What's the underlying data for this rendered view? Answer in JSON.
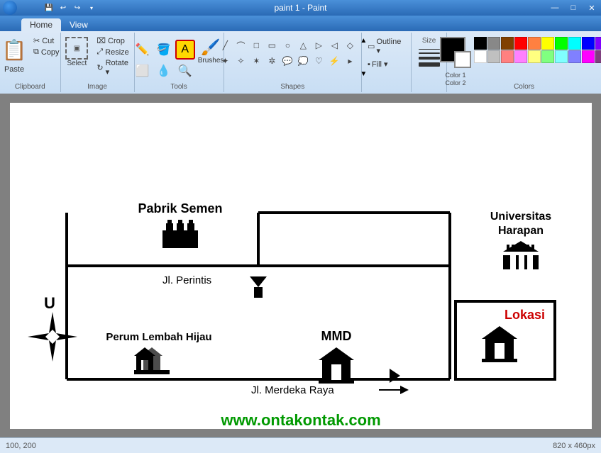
{
  "titlebar": {
    "title": "paint 1 - Paint",
    "min": "—",
    "max": "□",
    "close": "✕"
  },
  "quickaccess": {
    "save": "💾",
    "undo": "↩",
    "redo": "↪",
    "dropdown": "▾"
  },
  "ribbon": {
    "tabs": [
      {
        "id": "home",
        "label": "Home",
        "active": true
      },
      {
        "id": "view",
        "label": "View",
        "active": false
      }
    ],
    "groups": {
      "clipboard": {
        "label": "Clipboard",
        "paste": "Paste",
        "cut": "Cut",
        "copy": "Copy"
      },
      "image": {
        "label": "Image",
        "crop": "Crop",
        "resize": "Resize",
        "rotate": "Rotate ▾",
        "select": "Select"
      },
      "tools": {
        "label": "Tools",
        "brushes": "Brushes"
      },
      "shapes": {
        "label": "Shapes"
      },
      "colors": {
        "label": "Colors",
        "color1": "Color 1",
        "color2": "Color 2",
        "size": "Size"
      }
    }
  },
  "map": {
    "title_pabrik": "Pabrik Semen",
    "title_univ": "Universitas\nHarapan",
    "label_perum": "Perum Lembah Hijau",
    "label_mmd": "MMD",
    "label_lokasi": "Lokasi",
    "street1": "Jl. Perintis",
    "street2": "Jl. Merdeka Raya",
    "website": "www.ontakontak.com",
    "north": "U"
  },
  "palette_colors": [
    "#000000",
    "#888888",
    "#804000",
    "#ff0000",
    "#ff8040",
    "#ffff00",
    "#00ff00",
    "#00ffff",
    "#0000ff",
    "#8000ff",
    "#ffffff",
    "#c0c0c0",
    "#ff8080",
    "#ff80ff",
    "#ffff80",
    "#80ff80",
    "#80ffff",
    "#8080ff",
    "#ff00ff",
    "#804080"
  ],
  "color1": "#000000",
  "color2": "#ffffff",
  "status": {
    "coords": "100, 200",
    "size": "820 x 460px"
  }
}
